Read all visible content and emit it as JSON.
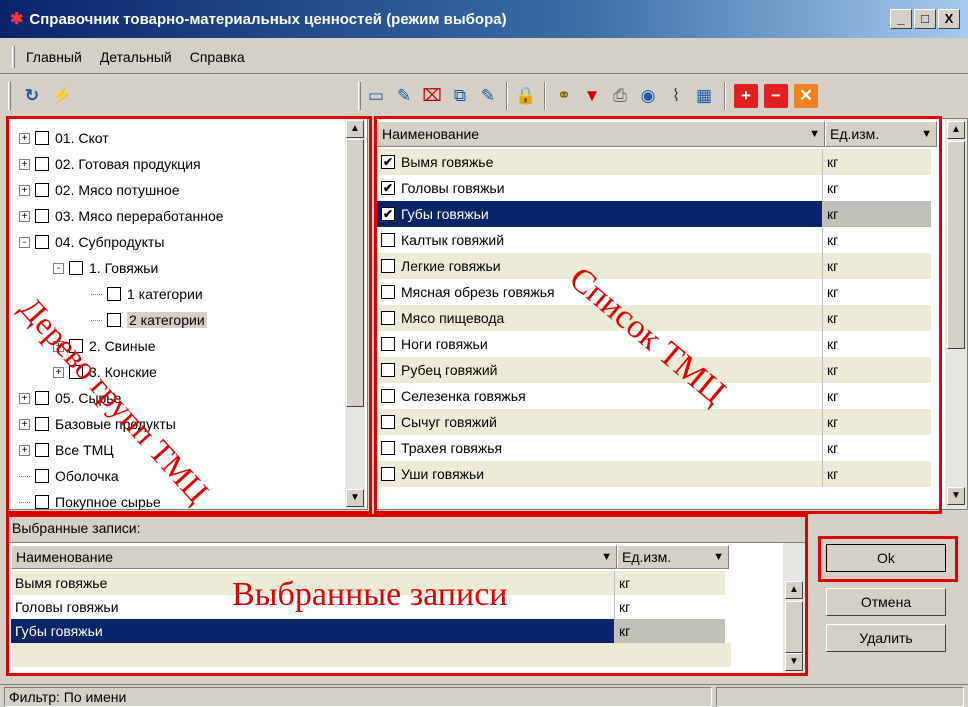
{
  "window": {
    "title": "Справочник товарно-материальных ценностей (режим выбора)",
    "btn_min": "_",
    "btn_max": "□",
    "btn_close": "X"
  },
  "menu": [
    "Главный",
    "Детальный",
    "Справка"
  ],
  "tree": {
    "items": [
      {
        "label": "01. Скот",
        "toggle": "+"
      },
      {
        "label": "02. Готовая продукция",
        "toggle": "+"
      },
      {
        "label": "02. Мясо потушное",
        "toggle": "+"
      },
      {
        "label": "03. Мясо переработанное",
        "toggle": "+"
      },
      {
        "label": "04. Субпродукты",
        "toggle": "-"
      },
      {
        "label": "1. Говяжьи",
        "toggle": "-"
      },
      {
        "label": "1 категории",
        "toggle": ""
      },
      {
        "label": "2 категории",
        "toggle": ""
      },
      {
        "label": "2. Свиные",
        "toggle": "+"
      },
      {
        "label": "3. Конские",
        "toggle": "+"
      },
      {
        "label": "05. Сырье",
        "toggle": "+"
      },
      {
        "label": "Базовые продукты",
        "toggle": "+"
      },
      {
        "label": "Все ТМЦ",
        "toggle": "+"
      },
      {
        "label": "Оболочка",
        "toggle": ""
      },
      {
        "label": "Покупное сырье",
        "toggle": ""
      }
    ]
  },
  "list": {
    "col_name": "Наименование",
    "col_unit": "Ед.изм.",
    "rows": [
      {
        "name": "Вымя говяжье",
        "unit": "кг",
        "check": "✔"
      },
      {
        "name": "Головы говяжьи",
        "unit": "кг",
        "check": "✔"
      },
      {
        "name": "Губы говяжьи",
        "unit": "кг",
        "check": "✔"
      },
      {
        "name": "Калтык говяжий",
        "unit": "кг",
        "check": ""
      },
      {
        "name": "Легкие говяжьи",
        "unit": "кг",
        "check": ""
      },
      {
        "name": "Мясная обрезь говяжья",
        "unit": "кг",
        "check": ""
      },
      {
        "name": "Мясо пищевода",
        "unit": "кг",
        "check": ""
      },
      {
        "name": "Ноги говяжьи",
        "unit": "кг",
        "check": ""
      },
      {
        "name": "Рубец говяжий",
        "unit": "кг",
        "check": ""
      },
      {
        "name": "Селезенка говяжья",
        "unit": "кг",
        "check": ""
      },
      {
        "name": "Сычуг говяжий",
        "unit": "кг",
        "check": ""
      },
      {
        "name": "Трахея говяжья",
        "unit": "кг",
        "check": ""
      },
      {
        "name": "Уши говяжьи",
        "unit": "кг",
        "check": ""
      }
    ]
  },
  "selected": {
    "label": "Выбранные записи:",
    "col_name": "Наименование",
    "col_unit": "Ед.изм.",
    "rows": [
      {
        "name": "Вымя говяжье",
        "unit": "кг"
      },
      {
        "name": "Головы говяжьи",
        "unit": "кг"
      },
      {
        "name": "Губы говяжьи",
        "unit": "кг"
      }
    ]
  },
  "buttons": {
    "ok": "Ok",
    "cancel": "Отмена",
    "delete": "Удалить"
  },
  "status": {
    "filter": "Фильтр: По имени"
  },
  "annotations": {
    "tree": "Дерево групп ТМЦ",
    "list": "Список ТМЦ",
    "selected": "Выбранные записи"
  },
  "icons": {
    "refresh": "↻",
    "lightning": "⚡",
    "folder": "▭",
    "edit": "✎",
    "delete": "⌧",
    "copy": "⧉",
    "multi-edit": "✎",
    "lock": "🔒",
    "find": "⚭",
    "filter": "▼",
    "print": "⎙",
    "view": "◉",
    "attach": "⌇",
    "calc": "▦",
    "add": "+",
    "remove": "−",
    "cancel": "✕"
  },
  "colors": {
    "title_start": "#0a246a",
    "accent_red": "#e00000",
    "selection": "#0a246a",
    "alt_row": "#ecebd8"
  }
}
